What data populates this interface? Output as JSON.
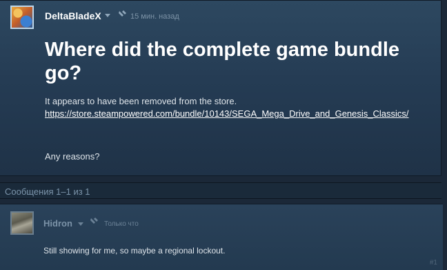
{
  "topic": {
    "author": "DeltaBladeX",
    "timestamp": "15 мин. назад",
    "title": "Where did the complete game bundle go?",
    "body_line1": "It appears to have been removed from the store.",
    "link": "https://store.steampowered.com/bundle/10143/SEGA_Mega_Drive_and_Genesis_Classics/",
    "body_line2": "Any reasons?"
  },
  "replies_bar": {
    "count_text": "Сообщения 1–1 из 1"
  },
  "reply": {
    "author": "Hidron",
    "timestamp": "Только что",
    "text": "Still showing for me, so maybe a regional lockout.",
    "number": "#1"
  },
  "icons": {
    "timestamp_icon": "pin-clock-icon",
    "dropdown_icon": "chevron-down-icon"
  }
}
